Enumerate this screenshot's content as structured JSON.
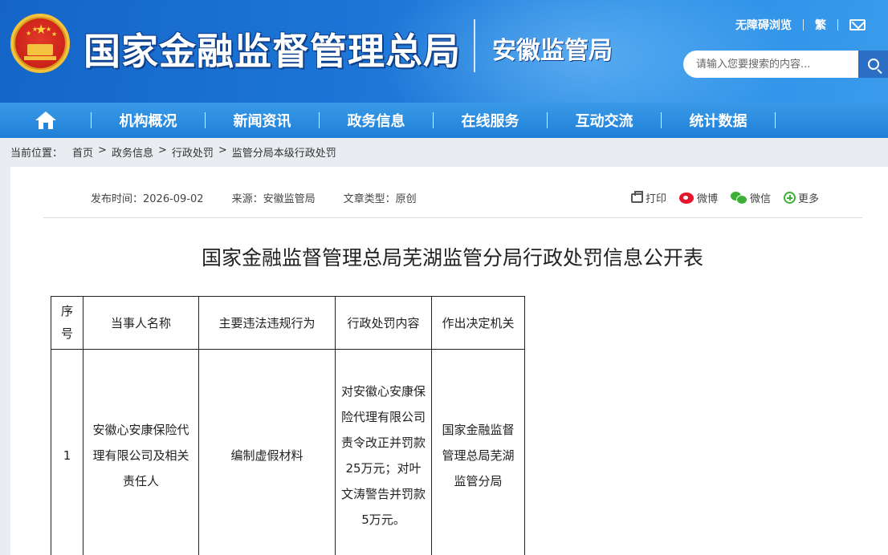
{
  "header": {
    "site_title": "国家金融监督管理总局",
    "sub_title": "安徽监管局",
    "accessibility_link": "无障碍浏览",
    "traditional_link": "繁",
    "search_placeholder": "请输入您要搜索的内容..."
  },
  "nav": {
    "items": [
      {
        "label": "机构概况"
      },
      {
        "label": "新闻资讯"
      },
      {
        "label": "政务信息"
      },
      {
        "label": "在线服务"
      },
      {
        "label": "互动交流"
      },
      {
        "label": "统计数据"
      }
    ]
  },
  "breadcrumb": {
    "label": "当前位置：",
    "items": [
      "首页",
      "政务信息",
      "行政处罚",
      "监管分局本级行政处罚"
    ],
    "separator": ">"
  },
  "article": {
    "publish_time": "发布时间：2026-09-02",
    "source": "来源：安徽监管局",
    "type": "文章类型：原创",
    "title": "国家金融监督管理总局芜湖监管分局行政处罚信息公开表"
  },
  "share": {
    "print": "打印",
    "weibo": "微博",
    "wechat": "微信",
    "more": "更多"
  },
  "table": {
    "headers": [
      "序号",
      "当事人名称",
      "主要违法违规行为",
      "行政处罚内容",
      "作出决定机关"
    ],
    "rows": [
      {
        "no": "1",
        "party": "安徽心安康保险代理有限公司及相关责任人",
        "violation": "编制虚假材料",
        "penalty": "对安徽心安康保险代理有限公司责令改正并罚款25万元；对叶文涛警告并罚款5万元。",
        "authority": "国家金融监督管理总局芜湖监管分局"
      }
    ]
  },
  "colors": {
    "header_blue": "#1d78d8",
    "nav_blue": "#2484da",
    "page_bg": "#e9ecf0"
  }
}
